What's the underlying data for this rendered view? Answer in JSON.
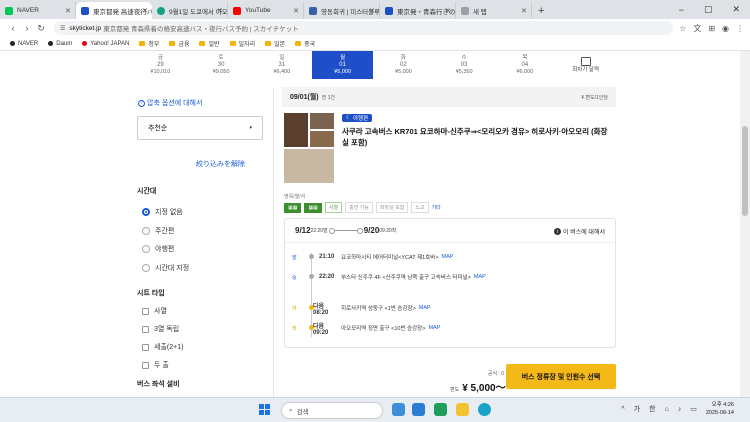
{
  "browser": {
    "tabs": [
      {
        "label": "NAVER",
        "color": "#03c75a",
        "active": false
      },
      {
        "label": "東京都発 高速夜行バス",
        "color": "#1e4ec8",
        "active": true
      },
      {
        "label": "9월1일 도쿄에서 아오모",
        "color": "#10a37f",
        "active": false
      },
      {
        "label": "YouTube",
        "color": "#ff0000",
        "active": false
      },
      {
        "label": "영동회귀 | 미스터블루",
        "color": "#3b5ea8",
        "active": false
      },
      {
        "label": "東京発・青森行きの高",
        "color": "#1e4ec8",
        "active": false
      },
      {
        "label": "새 탭",
        "color": "#9aa0a6",
        "active": false
      }
    ],
    "new_tab": "+",
    "window_controls": [
      "−",
      "▢",
      "✕"
    ],
    "address": {
      "host": "skyticket.jp",
      "rest": "東京都発 青森県着の格安高速バス・夜行バス予約 | スカイチケット"
    },
    "bookmarks": [
      {
        "label": "NAVER",
        "kind": "dot"
      },
      {
        "label": "Daum",
        "kind": "dot"
      },
      {
        "label": "Yahoo! JAPAN",
        "kind": "dot-red"
      },
      {
        "label": "정부",
        "kind": "folder"
      },
      {
        "label": "금융",
        "kind": "folder"
      },
      {
        "label": "일반",
        "kind": "folder"
      },
      {
        "label": "일자리",
        "kind": "folder"
      },
      {
        "label": "일본",
        "kind": "folder"
      },
      {
        "label": "중국",
        "kind": "folder"
      }
    ]
  },
  "dates": [
    {
      "wd": "금",
      "d": "29",
      "price": "¥10,010"
    },
    {
      "wd": "토",
      "d": "30",
      "price": "¥9,050"
    },
    {
      "wd": "일",
      "d": "31",
      "price": "¥6,400"
    },
    {
      "wd": "월",
      "d": "01",
      "price": "¥5,000"
    },
    {
      "wd": "화",
      "d": "02",
      "price": "¥5,000"
    },
    {
      "wd": "수",
      "d": "03",
      "price": "¥5,350"
    },
    {
      "wd": "목",
      "d": "04",
      "price": "¥6,000"
    }
  ],
  "calendar_label": "회차가 달력",
  "sidebar": {
    "help": "압축 옵션에 대해서",
    "sort": "추천순",
    "reset": "絞り込みを解除",
    "time_title": "시간대",
    "time_opts": [
      "지정 없음",
      "주간편",
      "야행편",
      "시간대 지정"
    ],
    "seat_title": "시트 타입",
    "seat_opts": [
      "사열",
      "3열 독립",
      "세출(2+1)",
      "두 출"
    ],
    "equip_title": "버스 좌석 설비"
  },
  "result": {
    "date": "09/01(월)",
    "count": "전 1건",
    "unit": "¥ 편도/1인당",
    "night_badge": "야행편",
    "title": "사쿠라 고속버스 KR701 요코하마-신주쿠⇒<모리오카 경유> 히로사키·아오모리 (화장실 포함)",
    "bus_meta": "명목/열/석",
    "tags": [
      "사열",
      "충전 가능",
      "화장실 포함",
      "노교"
    ],
    "more": "기타",
    "dep_date": "9/12",
    "dep_time": "22:20발",
    "arr_date": "9/20",
    "arr_time": "09:20착",
    "bus_info": "이 버스에 대해서",
    "stops": [
      {
        "lbl": "발",
        "tm": "21:10",
        "nm": "요코하마시티 에어터미널<YCAT 제1호바>",
        "map": "MAP"
      },
      {
        "lbl": "승",
        "tm": "22:20",
        "nm": "부스타 신주쿠 4F <신주쿠역 남쪽 출구 고속버스 터미널>",
        "map": "MAP"
      },
      {
        "lbl": "하",
        "tm": "다음 08:20",
        "nm": "히로사키역 성동구 <1번 승강장>",
        "map": "MAP"
      },
      {
        "lbl": "착",
        "tm": "다음 09:20",
        "nm": "아오모리역 정면 출구 <10번 승강장>",
        "map": "MAP"
      }
    ],
    "fare_label": "공식 : 0",
    "price_prefix": "편도",
    "price": "¥ 5,000〜",
    "select": "버스 정류장 및 인원수 선택"
  },
  "taskbar": {
    "search": "검색",
    "ime1": "가",
    "ime2": "한",
    "time": "오후 4:26",
    "date": "2025-08-14"
  }
}
